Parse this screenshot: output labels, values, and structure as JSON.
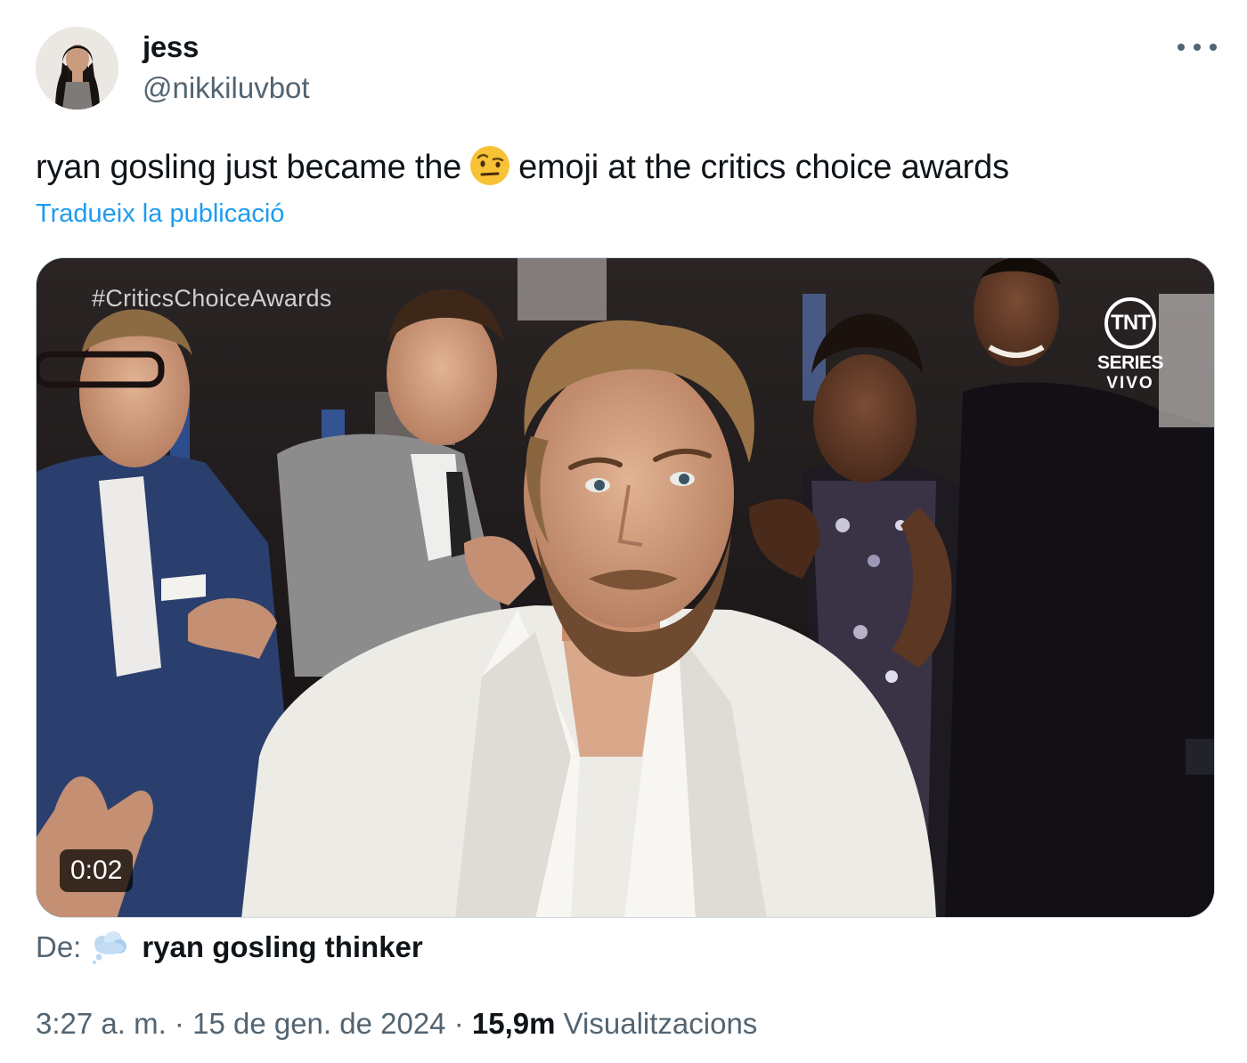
{
  "author": {
    "display_name": "jess",
    "handle": "@nikkiluvbot"
  },
  "tweet": {
    "text_before": "ryan gosling just became the",
    "emoji_icon": "face-with-raised-eyebrow-emoji",
    "text_after": "emoji at the critics choice awards",
    "translate_label": "Tradueix la publicació"
  },
  "media": {
    "overlay_hashtag": "#CriticsChoiceAwards",
    "network_logo": "TNT",
    "network_line1": "SERIES",
    "network_line2": "VIVO",
    "duration": "0:02"
  },
  "source": {
    "prefix": "De:",
    "icon": "thought-balloon-icon",
    "name": "ryan gosling thinker"
  },
  "meta": {
    "time": "3:27 a. m.",
    "sep1": "·",
    "date": "15 de gen. de 2024",
    "sep2": "·",
    "views_count": "15,9m",
    "views_label": "Visualitzacions"
  },
  "colors": {
    "link": "#1d9bf0",
    "secondary_text": "#536471",
    "primary_text": "#0f1419"
  }
}
